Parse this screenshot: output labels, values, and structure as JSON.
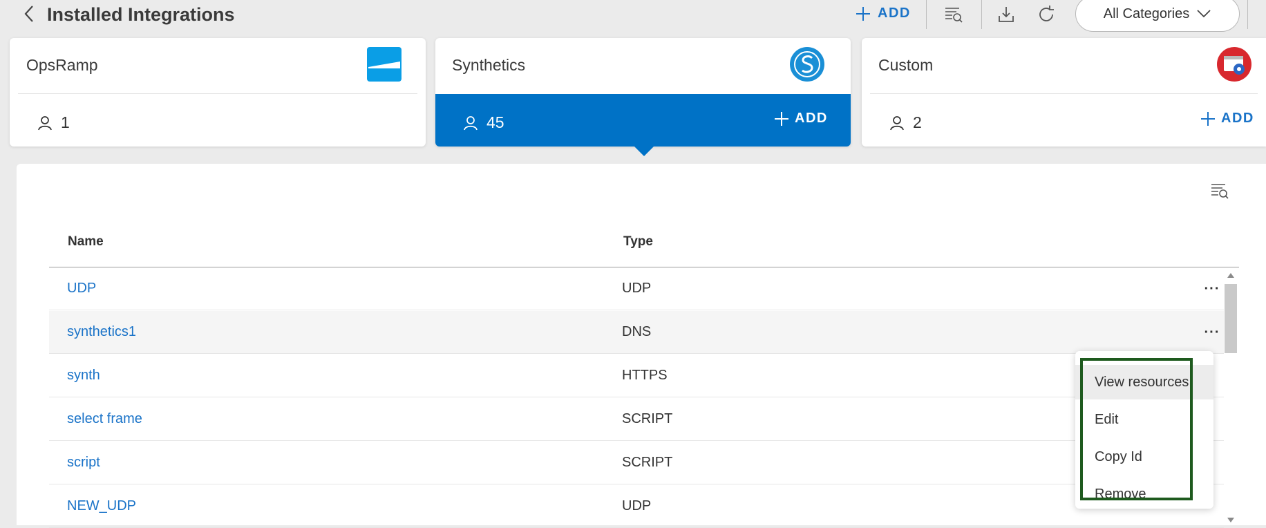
{
  "header": {
    "title": "Installed Integrations",
    "add_label": "ADD",
    "category_select": "All Categories"
  },
  "cards": [
    {
      "name": "OpsRamp",
      "count": "1",
      "logo": "opsramp-logo",
      "active": false
    },
    {
      "name": "Synthetics",
      "count": "45",
      "add_label": "ADD",
      "logo": "synthetics-logo",
      "active": true
    },
    {
      "name": "Custom",
      "count": "2",
      "add_label": "ADD",
      "logo": "custom-api-logo",
      "active": false
    }
  ],
  "table": {
    "columns": [
      "Name",
      "Type"
    ],
    "rows": [
      {
        "name": "UDP",
        "type": "UDP"
      },
      {
        "name": "synthetics1",
        "type": "DNS"
      },
      {
        "name": "synth",
        "type": "HTTPS"
      },
      {
        "name": "select frame",
        "type": "SCRIPT"
      },
      {
        "name": "script",
        "type": "SCRIPT"
      },
      {
        "name": "NEW_UDP",
        "type": "UDP"
      }
    ],
    "row_menu_label": "···"
  },
  "context_menu": {
    "items": [
      "View resources",
      "Edit",
      "Copy Id",
      "Remove"
    ]
  },
  "colors": {
    "accent": "#0072c6",
    "link": "#1a73c8",
    "outline": "#1e5a1e"
  }
}
